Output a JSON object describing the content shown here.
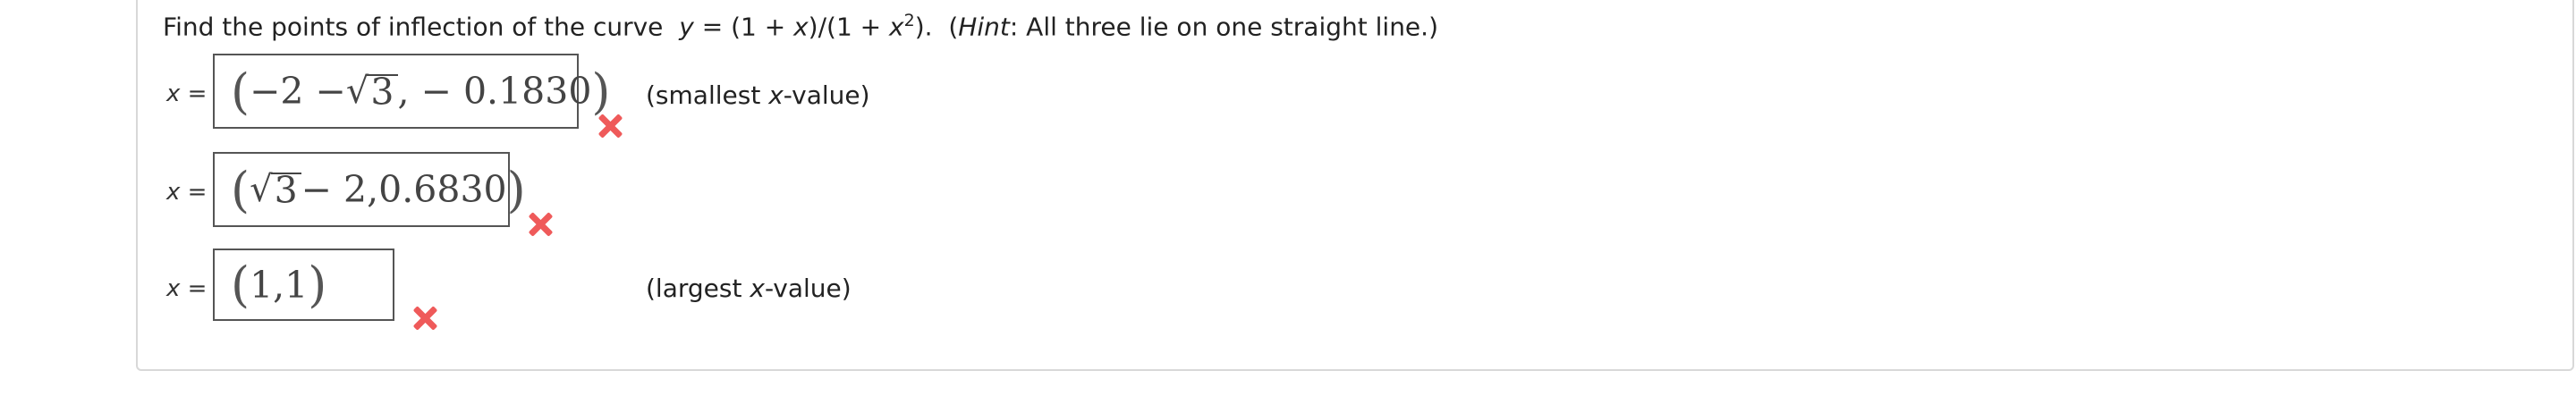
{
  "question": {
    "prefix": "Find the points of inflection of the curve",
    "eq_y": "y",
    "eq_mid1": " = (1 + ",
    "eq_x1": "x",
    "eq_mid2": ")/(1 + ",
    "eq_x2": "x",
    "eq_exp": "2",
    "eq_end": ").",
    "hint_open": "(",
    "hint_word": "Hint",
    "hint_text": ": All three lie on one straight line.)"
  },
  "answers": [
    {
      "label_var": "x",
      "label_eq": " =",
      "display": {
        "open": "(",
        "pre": "−2 − ",
        "radical": "√",
        "radicand": "3",
        "post": ", − 0.1830",
        "close": ")"
      },
      "note_open": "(smallest ",
      "note_var": "x",
      "note_close": "-value)",
      "status": "incorrect"
    },
    {
      "label_var": "x",
      "label_eq": " =",
      "display": {
        "open": "(",
        "radical": "√",
        "radicand": "3",
        "post": " − 2,0.6830",
        "close": ")"
      },
      "note_open": "",
      "note_var": "",
      "note_close": "",
      "status": "incorrect"
    },
    {
      "label_var": "x",
      "label_eq": " =",
      "display": {
        "open": "(",
        "post": "1,1",
        "close": ")"
      },
      "note_open": "(largest ",
      "note_var": "x",
      "note_close": "-value)",
      "status": "incorrect"
    }
  ],
  "colors": {
    "incorrect": "#ef5a5a",
    "border": "#555555"
  }
}
